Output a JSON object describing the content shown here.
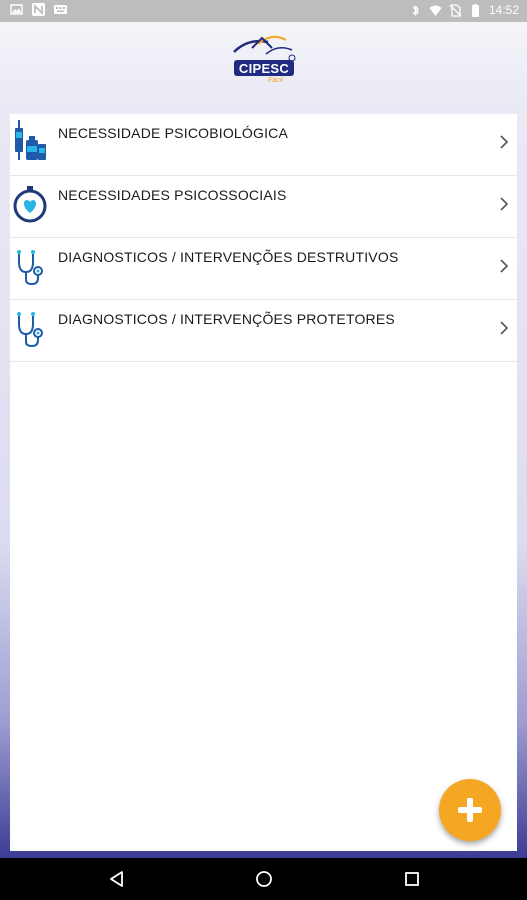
{
  "status_bar": {
    "time": "14:52",
    "left_icons": [
      "image-icon",
      "n-notification-icon",
      "keyboard-icon"
    ],
    "right_icons": [
      "bluetooth-icon",
      "wifi-icon",
      "no-sim-icon",
      "battery-icon"
    ]
  },
  "header": {
    "logo_text": "CIPESC",
    "logo_subtext": "Fácil"
  },
  "menu": {
    "items": [
      {
        "label": "NECESSIDADE PSICOBIOLÓGICA",
        "icon": "medicine-bottles-icon"
      },
      {
        "label": "NECESSIDADES PSICOSSOCIAIS",
        "icon": "stopwatch-heart-icon"
      },
      {
        "label": "DIAGNOSTICOS /  INTERVENÇÕES DESTRUTIVOS",
        "icon": "stethoscope-icon"
      },
      {
        "label": "DIAGNOSTICOS / INTERVENÇÕES PROTETORES",
        "icon": "stethoscope-icon"
      }
    ]
  },
  "fab": {
    "icon": "plus-icon",
    "color": "#f5a623"
  },
  "colors": {
    "accent": "#f5a623",
    "icon_blue": "#1e5aa8",
    "icon_cyan": "#29b6e6",
    "logo_navy": "#1f2a80"
  },
  "nav_bar": {
    "buttons": [
      "back-icon",
      "home-icon",
      "recents-icon"
    ]
  }
}
